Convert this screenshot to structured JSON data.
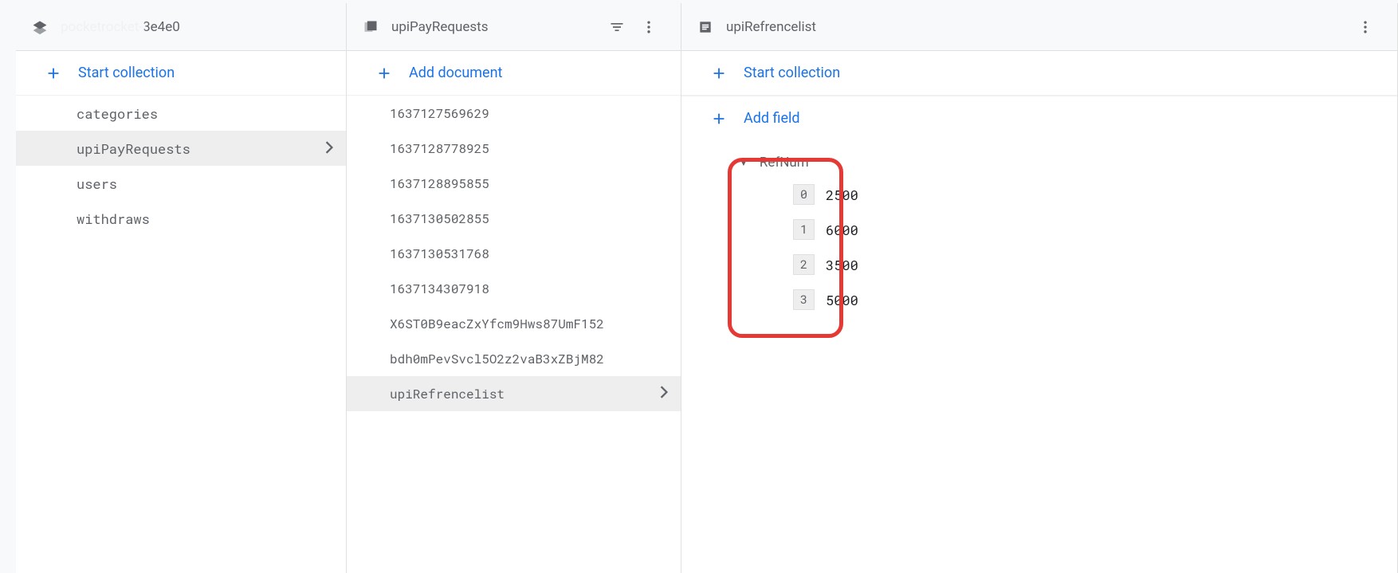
{
  "panel1": {
    "projectName": "pocketrocket-3e4e0",
    "startCollectionLabel": "Start collection",
    "collections": [
      "categories",
      "upiPayRequests",
      "users",
      "withdraws"
    ],
    "selectedCollection": "upiPayRequests"
  },
  "panel2": {
    "title": "upiPayRequests",
    "addDocumentLabel": "Add document",
    "documents": [
      "1637127569629",
      "1637128778925",
      "1637128895855",
      "1637130502855",
      "1637130531768",
      "1637134307918",
      "X6ST0B9eacZxYfcm9Hws87UmF152",
      "bdh0mPevSvcl5O2z2vaB3xZBjM82",
      "upiRefrencelist"
    ],
    "selectedDocument": "upiRefrencelist"
  },
  "panel3": {
    "title": "upiRefrencelist",
    "startCollectionLabel": "Start collection",
    "addFieldLabel": "Add field",
    "fieldName": "RefNum",
    "refNum": [
      {
        "index": "0",
        "value": "2500"
      },
      {
        "index": "1",
        "value": "6000"
      },
      {
        "index": "2",
        "value": "3500"
      },
      {
        "index": "3",
        "value": "5000"
      }
    ]
  }
}
